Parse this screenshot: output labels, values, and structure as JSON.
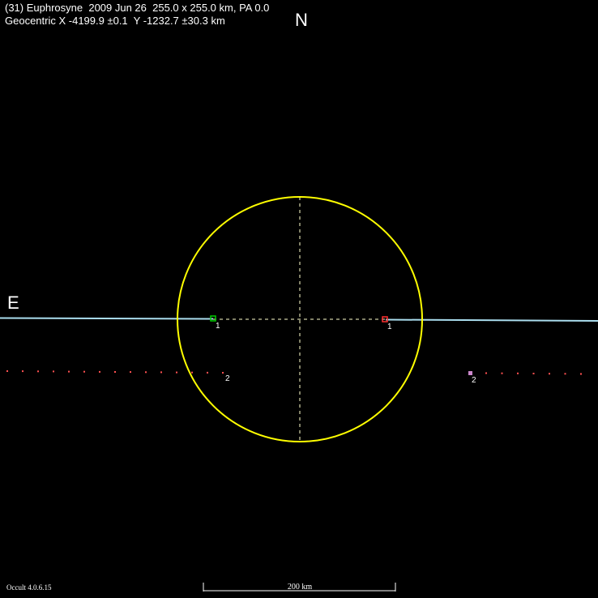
{
  "header": {
    "title": "(31) Euphrosyne  2009 Jun 26  255.0 x 255.0 km, PA 0.0",
    "geocentric": "Geocentric X -4199.9 ±0.1  Y -1232.7 ±30.3 km"
  },
  "compass": {
    "north": "N",
    "east": "E"
  },
  "footer": {
    "version": "Occult 4.0.6.15",
    "scale_label": "200 km",
    "scale_km": 200
  },
  "colors": {
    "ellipse": "#ffff00",
    "axes": "#ffffcc",
    "chord1": "#aaddee",
    "chord2_dots": "#ff5050",
    "disappear_marker": "#00cc00",
    "reappear_marker": "#ff3030",
    "chord2_marker": "#cc88cc"
  },
  "diagram": {
    "ellipse_major_km": 255.0,
    "ellipse_minor_km": 255.0,
    "position_angle": 0.0,
    "chords": [
      {
        "label": "1",
        "result": "positive"
      },
      {
        "label": "2",
        "result": "miss"
      }
    ]
  }
}
